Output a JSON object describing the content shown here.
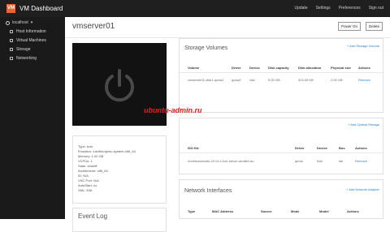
{
  "app": {
    "logo_text": "VM",
    "title": "VM Dashboard"
  },
  "topnav": [
    "Update",
    "Settings",
    "Preferences",
    "Sign out"
  ],
  "sidebar": {
    "host": "localhost",
    "items": [
      "Host Information",
      "Virtual Machines",
      "Storage",
      "Networking"
    ]
  },
  "vm": {
    "name": "vmserver01",
    "power_on_label": "Power On",
    "delete_label": "Delete",
    "details": [
      "Type: kvm",
      "Emulator: /usr/bin/qemu-system-x86_64",
      "Memory: 1.00 GB",
      "VCPUs: 1",
      "State: shutoff",
      "Architecture: x86_64",
      "ID: N/A",
      "VNC Port: N/A",
      "AutoStart: no",
      "XML: Edit"
    ],
    "event_log_title": "Event Log"
  },
  "storage_volumes": {
    "title": "Storage Volumes",
    "add_label": "+ Add Storage Volume",
    "columns": [
      "Volume",
      "Driver",
      "Device",
      "Disk capacity",
      "Disk allocation",
      "Physical size",
      "Actions"
    ],
    "rows": [
      [
        "vmserver01-disk1.qcow2",
        "qcow2",
        "vda",
        "5.00 GB",
        "324.00 KB",
        "2.00 GB",
        "Remove"
      ]
    ]
  },
  "optical": {
    "add_label": "+ Add Optical Storage",
    "columns": [
      "ISO file",
      "Driver",
      "Device",
      "Bus",
      "Actions"
    ],
    "rows": [
      [
        "/mnt/iso/ubuntu-20.04.1-live-server-amd64.iso",
        "qemu",
        "hda",
        "ide",
        "Remove"
      ]
    ]
  },
  "network": {
    "title": "Network Interfaces",
    "add_label": "+ Add Network Adapter",
    "columns": [
      "Type",
      "MAC Address",
      "Source",
      "Mode",
      "Model",
      "Actions"
    ]
  },
  "watermark": "ubuntu-admin.ru",
  "colors": {
    "topbar": "#1f1f1f",
    "sidebar": "#1a1a1a",
    "accent": "#e8643a",
    "link": "#2a7fc4",
    "console": "#121212"
  }
}
